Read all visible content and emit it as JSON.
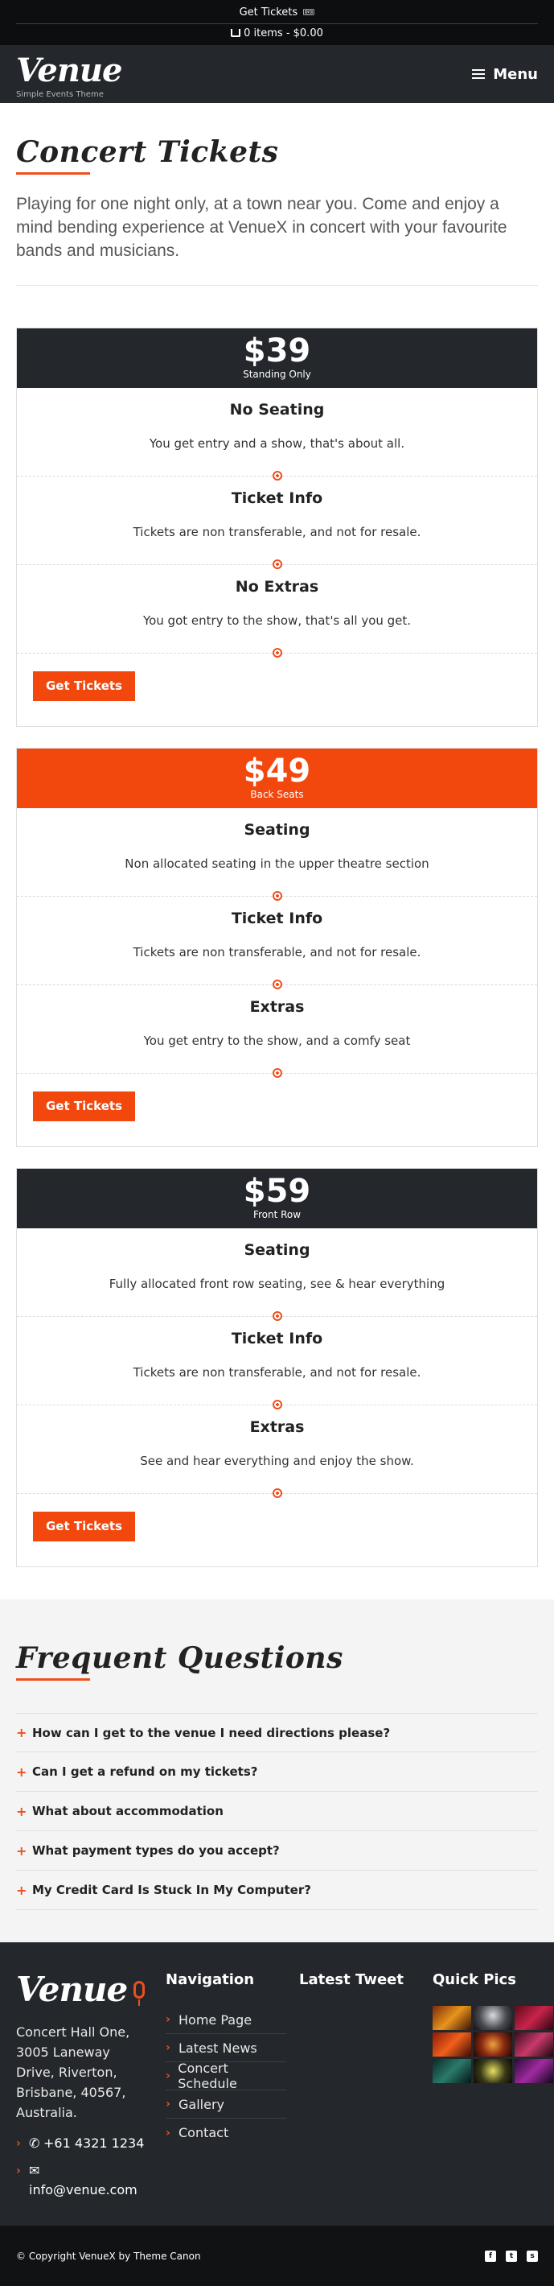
{
  "topbar": {
    "get_tickets": "Get Tickets",
    "cart": "0 items - $0.00"
  },
  "header": {
    "logo": "Venue",
    "tagline": "Simple Events Theme",
    "menu_label": "Menu"
  },
  "intro": {
    "title": "Concert Tickets",
    "text": "Playing for one night only, at a town near you. Come and enjoy a mind bending experience at VenueX in concert with your favourite bands and musicians."
  },
  "cards": [
    {
      "price": "$39",
      "label": "Standing Only",
      "features": [
        {
          "title": "No Seating",
          "text": "You get entry and a show, that's about all."
        },
        {
          "title": "Ticket Info",
          "text": "Tickets are non transferable, and not for resale."
        },
        {
          "title": "No Extras",
          "text": "You got entry to the show, that's all you get."
        }
      ],
      "button": "Get Tickets"
    },
    {
      "price": "$49",
      "label": "Back Seats",
      "features": [
        {
          "title": "Seating",
          "text": "Non allocated seating in the upper theatre section"
        },
        {
          "title": "Ticket Info",
          "text": "Tickets are non transferable, and not for resale."
        },
        {
          "title": "Extras",
          "text": "You get entry to the show, and a comfy seat"
        }
      ],
      "button": "Get Tickets"
    },
    {
      "price": "$59",
      "label": "Front Row",
      "features": [
        {
          "title": "Seating",
          "text": "Fully allocated front row seating, see & hear everything"
        },
        {
          "title": "Ticket Info",
          "text": "Tickets are non transferable, and not for resale."
        },
        {
          "title": "Extras",
          "text": "See and hear everything and enjoy the show."
        }
      ],
      "button": "Get Tickets"
    }
  ],
  "faq": {
    "title": "Frequent Questions",
    "items": [
      "How can I get to the venue I need directions please?",
      "Can I get a refund on my tickets?",
      "What about accommodation",
      "What payment types do you accept?",
      "My Credit Card Is Stuck In My Computer?"
    ]
  },
  "footer": {
    "logo": "Venue",
    "address": "Concert Hall One, 3005 Laneway Drive, Riverton, Brisbane, 40567, Australia.",
    "phone": "+61 4321 1234",
    "email": "info@venue.com",
    "nav_title": "Navigation",
    "nav": [
      "Home Page",
      "Latest News",
      "Concert Schedule",
      "Gallery",
      "Contact"
    ],
    "tweet_title": "Latest Tweet",
    "pics_title": "Quick Pics",
    "copyright": "© Copyright VenueX by Theme Canon"
  },
  "colors": {
    "accent": "#f2470d",
    "dark": "#24272b"
  }
}
